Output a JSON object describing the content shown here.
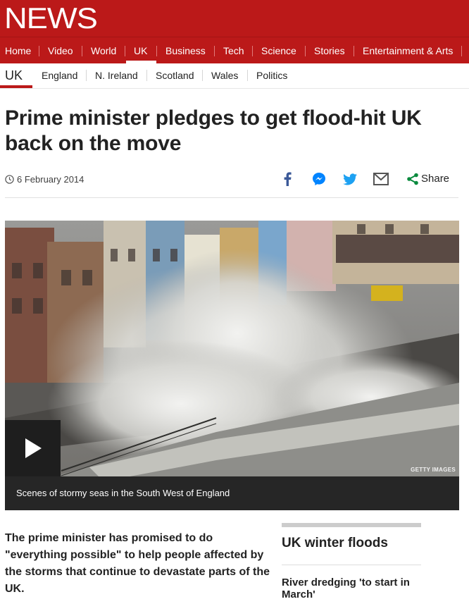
{
  "brand": {
    "logo_text": "NEWS",
    "color": "#bb1919"
  },
  "nav": {
    "items": [
      {
        "label": "Home",
        "active": false
      },
      {
        "label": "Video",
        "active": false
      },
      {
        "label": "World",
        "active": false
      },
      {
        "label": "UK",
        "active": true
      },
      {
        "label": "Business",
        "active": false
      },
      {
        "label": "Tech",
        "active": false
      },
      {
        "label": "Science",
        "active": false
      },
      {
        "label": "Stories",
        "active": false
      },
      {
        "label": "Entertainment & Arts",
        "active": false
      }
    ]
  },
  "subnav": {
    "current": "UK",
    "items": [
      "England",
      "N. Ireland",
      "Scotland",
      "Wales",
      "Politics"
    ]
  },
  "article": {
    "headline": "Prime minister pledges to get flood-hit UK back on the move",
    "date": "6 February 2014",
    "share_label": "Share",
    "share_icons": [
      "facebook-icon",
      "messenger-icon",
      "twitter-icon",
      "email-icon",
      "share-icon"
    ],
    "media": {
      "caption": "Scenes of stormy seas in the South West of England",
      "credit": "GETTY IMAGES"
    },
    "intro": "The prime minister has promised to do \"everything possible\" to help people affected by the storms that continue to devastate parts of the UK."
  },
  "aside": {
    "title": "UK winter floods",
    "link": "River dredging 'to start in March'"
  }
}
